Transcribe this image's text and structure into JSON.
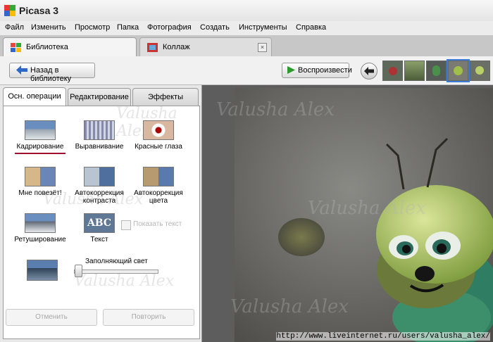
{
  "window": {
    "title": "Picasa 3"
  },
  "menu": [
    "Файл",
    "Изменить",
    "Просмотр",
    "Папка",
    "Фотография",
    "Создать",
    "Инструменты",
    "Справка"
  ],
  "tabs": {
    "library": "Библиотека",
    "collage": "Коллаж"
  },
  "toolbar": {
    "back_label": "Назад в библиотеку",
    "play_label": "Воспроизвести"
  },
  "panel": {
    "tabs": [
      "Осн. операции",
      "Редактирование",
      "Эффекты"
    ],
    "tools": {
      "crop": "Кадрирование",
      "straighten": "Выравнивание",
      "redeye": "Красные глаза",
      "lucky": "Мне повезёт!",
      "autocontrast": "Автокоррекция контраста",
      "autocolor": "Автокоррекция цвета",
      "retouch": "Ретуширование",
      "text": "Текст",
      "text_icon": "ABC",
      "show_text": "Показать текст",
      "fill_light": "Заполняющий свет",
      "fill_light_level": 0.0
    },
    "undo_label": "Отменить",
    "redo_label": "Повторить"
  },
  "watermark": "Valusha Alex",
  "footer_url": "http://www.liveinternet.ru/users/valusha_alex/"
}
